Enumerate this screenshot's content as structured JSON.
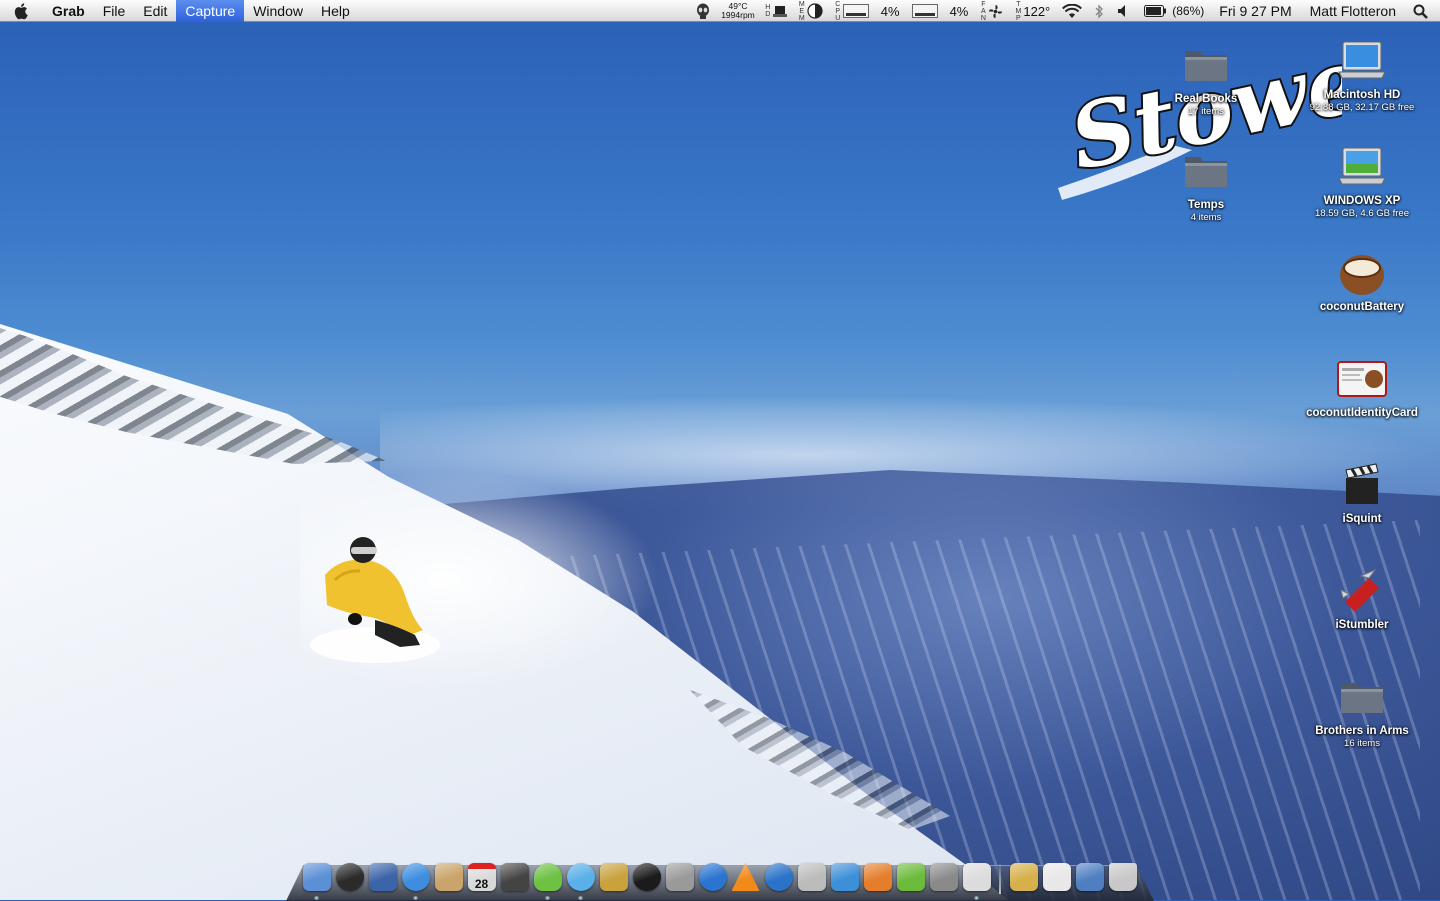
{
  "menubar": {
    "app_name": "Grab",
    "menus": [
      "File",
      "Edit",
      "Capture",
      "Window",
      "Help"
    ],
    "active_menu": "Capture",
    "temp": "49°C",
    "fan": "1994rpm",
    "cpu1": "4%",
    "cpu2": "4%",
    "sensor_temp": "122°",
    "battery": "(86%)",
    "clock": "Fri 9 27 PM",
    "user": "Matt Flotteron"
  },
  "logo_text": "Stowe",
  "desktop_icons": [
    {
      "label": "Real Books",
      "sub": "17 items",
      "icon": "folder-icon"
    },
    {
      "label": "Macintosh HD",
      "sub": "92.88 GB, 32.17 GB free",
      "icon": "hard-drive-icon"
    },
    {
      "label": "Temps",
      "sub": "4 items",
      "icon": "folder-icon"
    },
    {
      "label": "WINDOWS XP",
      "sub": "18.59 GB, 4.6 GB free",
      "icon": "windows-drive-icon"
    },
    {
      "label": "coconutBattery",
      "sub": "",
      "icon": "coconut-icon"
    },
    {
      "label": "coconutIdentityCard",
      "sub": "",
      "icon": "id-card-icon"
    },
    {
      "label": "iSquint",
      "sub": "",
      "icon": "clapperboard-icon"
    },
    {
      "label": "iStumbler",
      "sub": "",
      "icon": "swiss-knife-icon"
    },
    {
      "label": "Brothers in Arms",
      "sub": "16 items",
      "icon": "folder-icon"
    }
  ],
  "dock": {
    "calendar_day": "28",
    "colors": [
      "#5b8fd6",
      "#2b2b2b",
      "#3c64a8",
      "#3e8de0",
      "#caa46a",
      "#d8d8d8",
      "#444444",
      "#6dc143",
      "#5ab0e8",
      "#c9a13d",
      "#1b1b1b",
      "#9a9a9a",
      "#2b75d1",
      "#f28a1a",
      "#2a73c9",
      "#bcbcbc",
      "#3d8fd8",
      "#e57d2a",
      "#6cbb3c",
      "#8a8a8a",
      "#dcdcdc",
      "#d6b04a",
      "#e8e8e8",
      "#4f7fc0",
      "#c8c8c8"
    ]
  }
}
